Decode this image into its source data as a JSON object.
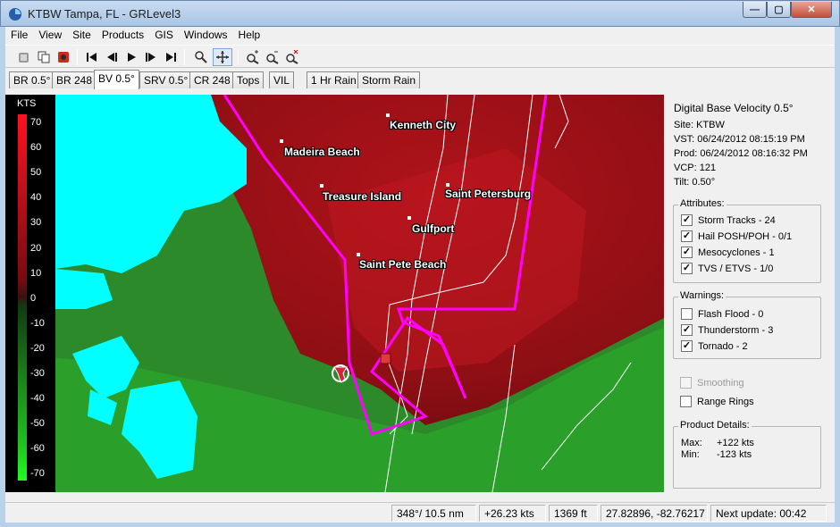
{
  "window": {
    "title": "KTBW Tampa, FL - GRLevel3",
    "minimize_label": "—",
    "maximize_label": "▢",
    "close_label": "✕"
  },
  "menu": [
    "File",
    "View",
    "Site",
    "Products",
    "GIS",
    "Windows",
    "Help"
  ],
  "toolbar": {
    "icons": [
      "open-icon",
      "copy-icon",
      "record-icon",
      "skip-first-icon",
      "step-back-icon",
      "play-icon",
      "step-forward-icon",
      "skip-last-icon",
      "zoom-icon",
      "pan-icon",
      "zoom-in-icon",
      "zoom-out-icon",
      "zoom-reset-icon"
    ]
  },
  "tabs": [
    {
      "label": "BR 0.5°"
    },
    {
      "label": "BR 248"
    },
    {
      "label": "BV 0.5°",
      "active": true
    },
    {
      "label": "SRV 0.5°"
    },
    {
      "label": "CR 248"
    },
    {
      "label": "Tops"
    },
    {
      "label": "VIL"
    },
    {
      "label": "1 Hr Rain"
    },
    {
      "label": "Storm Rain"
    }
  ],
  "legend": {
    "unit": "KTS",
    "ticks": [
      "70",
      "60",
      "50",
      "40",
      "30",
      "20",
      "10",
      "0",
      "-10",
      "-20",
      "-30",
      "-40",
      "-50",
      "-60",
      "-70"
    ]
  },
  "map": {
    "places": [
      "Kenneth City",
      "Madeira Beach",
      "Treasure Island",
      "Saint Petersburg",
      "Gulfport",
      "Saint Pete Beach"
    ]
  },
  "product": {
    "name": "Digital Base Velocity 0.5°",
    "site": "Site:  KTBW",
    "vst": "VST:  06/24/2012  08:15:19 PM",
    "prod": "Prod: 06/24/2012  08:16:32 PM",
    "vcp": "VCP:  121",
    "tilt": "Tilt:   0.50°"
  },
  "attributes": {
    "title": "Attributes:",
    "items": [
      {
        "label": "Storm Tracks - 24",
        "checked": true
      },
      {
        "label": "Hail POSH/POH - 0/1",
        "checked": true
      },
      {
        "label": "Mesocyclones - 1",
        "checked": true
      },
      {
        "label": "TVS / ETVS - 1/0",
        "checked": true
      }
    ]
  },
  "warnings": {
    "title": "Warnings:",
    "items": [
      {
        "label": "Flash Flood - 0",
        "checked": false
      },
      {
        "label": "Thunderstorm - 3",
        "checked": true
      },
      {
        "label": "Tornado - 2",
        "checked": true
      }
    ]
  },
  "options": {
    "smoothing": "Smoothing",
    "range_rings": "Range Rings"
  },
  "details": {
    "title": "Product Details:",
    "max_label": "Max:",
    "max_value": "+122 kts",
    "min_label": "Min:",
    "min_value": "-123 kts"
  },
  "status": {
    "bearing": "348°/ 10.5 nm",
    "velocity": "+26.23 kts",
    "height": "1369 ft",
    "coords": "27.82896, -82.76217",
    "next_update": "Next update: 00:42"
  },
  "colors": {
    "inbound_red": "#a0121a",
    "outbound_green": "#2e8b2a",
    "ground_clutter": "#00ffff",
    "warning_polygon": "#ff00ff"
  }
}
